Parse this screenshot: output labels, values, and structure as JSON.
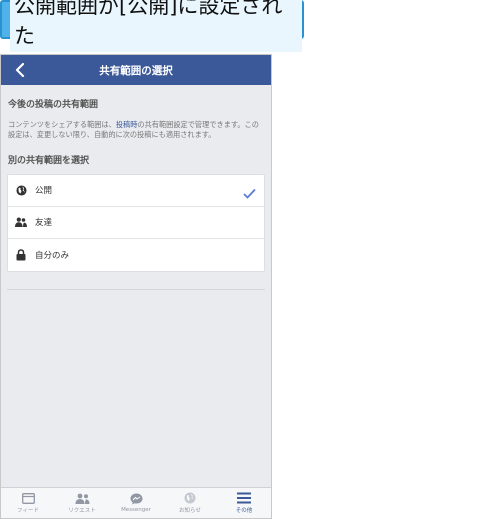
{
  "caption": {
    "text": "公開範囲が[公開]に設定された"
  },
  "navbar": {
    "title": "共有範囲の選択"
  },
  "current_section": {
    "title": "今後の投稿の共有範囲",
    "desc_before": "コンテンツをシェアする範囲は、",
    "desc_link": "投稿時",
    "desc_after": "の共有範囲設定で管理できます。この設定は、変更しない限り、自動的に次の投稿にも適用されます。"
  },
  "choose_section": {
    "title": "別の共有範囲を選択"
  },
  "options": [
    {
      "label": "公開",
      "icon": "globe-icon",
      "selected": true
    },
    {
      "label": "友達",
      "icon": "friends-icon",
      "selected": false
    },
    {
      "label": "自分のみ",
      "icon": "lock-icon",
      "selected": false
    }
  ],
  "tabbar": [
    {
      "label": "フィード",
      "icon": "feed-icon"
    },
    {
      "label": "リクエスト",
      "icon": "requests-icon"
    },
    {
      "label": "Messenger",
      "icon": "messenger-icon"
    },
    {
      "label": "お知らせ",
      "icon": "notifications-icon"
    },
    {
      "label": "その他",
      "icon": "menu-icon",
      "active": true
    }
  ],
  "colors": {
    "brand": "#3b5998",
    "accent_caption": "#4fb3ea",
    "check": "#5b7bd5"
  }
}
